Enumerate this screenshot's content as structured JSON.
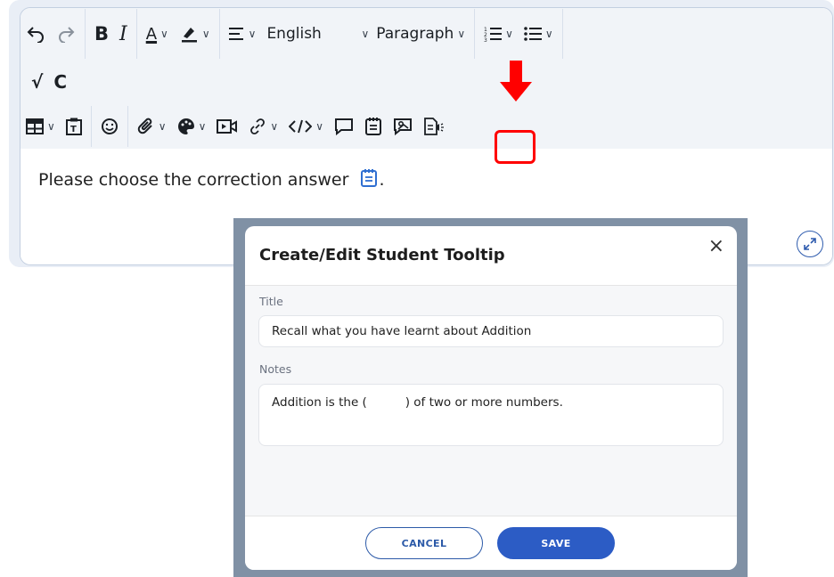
{
  "toolbar": {
    "language": "English",
    "block_format": "Paragraph"
  },
  "editor": {
    "content_text": "Please choose the correction answer",
    "trailing_punct": "."
  },
  "modal": {
    "title": "Create/Edit Student Tooltip",
    "close_glyph": "×",
    "title_label": "Title",
    "title_value": "Recall what you have learnt about Addition",
    "notes_label": "Notes",
    "notes_value": "Addition is the (          ) of two or more numbers.",
    "cancel_label": "CANCEL",
    "save_label": "SAVE"
  },
  "colors": {
    "accent": "#2c5cc5",
    "highlight": "#ff0000",
    "backdrop": "#8091a5"
  },
  "icons": {
    "undo": "undo-icon",
    "redo": "redo-icon",
    "bold": "bold-icon",
    "italic": "italic-icon",
    "font_color": "font-color-icon",
    "highlight_color": "highlight-color-icon",
    "align": "align-icon",
    "numbered_list": "numbered-list-icon",
    "bullet_list": "bullet-list-icon",
    "math": "math-icon",
    "chem": "chem-icon",
    "table": "table-icon",
    "paste": "paste-icon",
    "emoji": "emoji-icon",
    "attach": "attach-icon",
    "palette": "palette-icon",
    "video": "video-icon",
    "link": "link-icon",
    "code": "code-icon",
    "comment": "comment-icon",
    "student_tooltip": "student-tooltip-icon",
    "image_annotation": "image-annotation-icon",
    "audio_doc": "audio-doc-icon",
    "expand": "expand-icon"
  }
}
